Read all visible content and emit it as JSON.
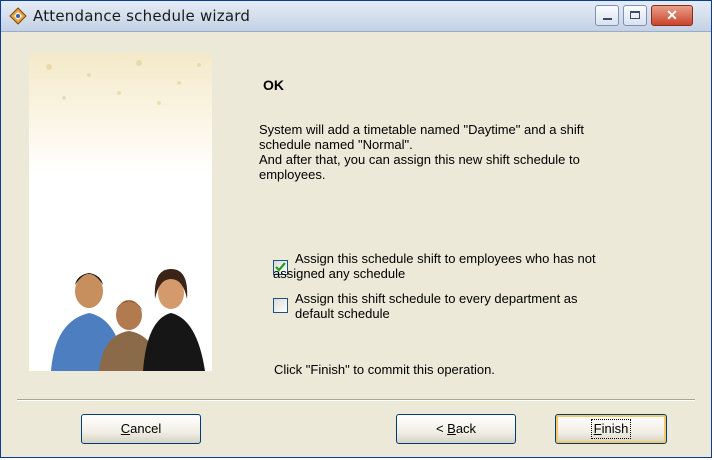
{
  "window": {
    "title": "Attendance schedule wizard",
    "controls": {
      "minimize": "minimize",
      "maximize": "maximize",
      "close": "✕"
    }
  },
  "content": {
    "heading": "OK",
    "description": [
      "System will add a timetable named \"Daytime\" and a shift",
      "schedule named \"Normal\".",
      "And after that, you can assign this new shift schedule to",
      "employees."
    ],
    "options": [
      {
        "label_line1": "Assign this schedule shift to employees who has not",
        "label_line2": "assigned any schedule",
        "checked": true
      },
      {
        "label_line1": "Assign this shift schedule to every department as",
        "label_line2": "default schedule",
        "checked": false
      }
    ],
    "footer": "Click \"Finish\" to commit this operation."
  },
  "buttons": {
    "cancel": {
      "accel": "C",
      "rest": "ancel"
    },
    "back": {
      "prefix": "< ",
      "accel": "B",
      "rest": "ack"
    },
    "finish": {
      "accel": "F",
      "rest": "inish"
    }
  },
  "colors": {
    "accent": "#0b3d91",
    "check": "#21a121",
    "close_button": "#c9442a"
  }
}
